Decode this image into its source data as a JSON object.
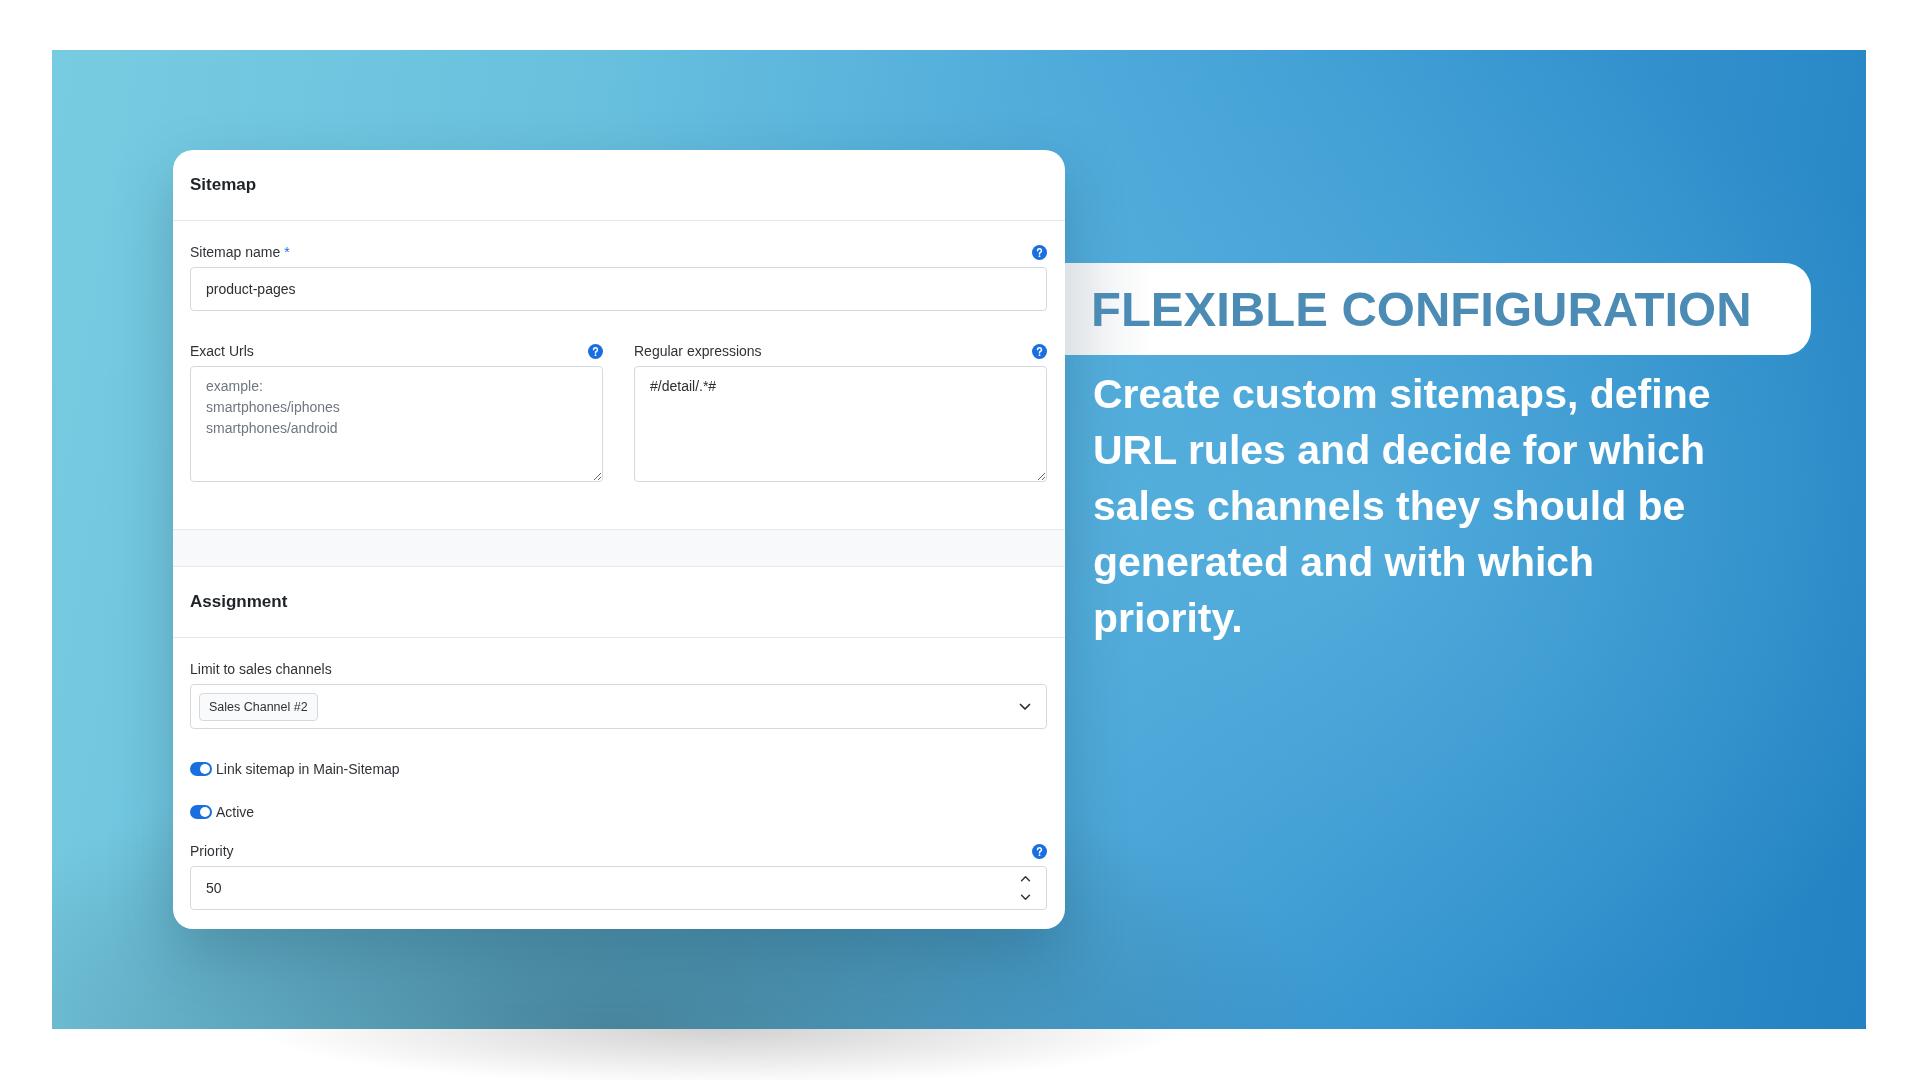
{
  "card": {
    "sections": [
      {
        "title": "Sitemap",
        "rows": [
          [
            {
              "kind": "input",
              "label": "Sitemap name",
              "required_mark": "*",
              "help": true,
              "value": "product-pages"
            }
          ],
          [
            {
              "kind": "textarea",
              "label": "Exact Urls",
              "help": true,
              "placeholder": "example:\nsmartphones/iphones\nsmartphones/android"
            },
            {
              "kind": "textarea",
              "label": "Regular expressions",
              "help": true,
              "value": "#/detail/.*#"
            }
          ]
        ]
      },
      {
        "title": "Assignment",
        "rows": [
          [
            {
              "kind": "multiselect",
              "label": "Limit to sales channels",
              "help": false,
              "tags": [
                "Sales Channel #2"
              ]
            }
          ],
          [
            {
              "kind": "switch",
              "label": "Link sitemap in Main-Sitemap",
              "help": false,
              "on": true
            }
          ],
          [
            {
              "kind": "switch",
              "label": "Active",
              "help": false,
              "on": true
            }
          ],
          [
            {
              "kind": "number",
              "label": "Priority",
              "help": true,
              "value": "50"
            }
          ]
        ]
      }
    ]
  },
  "promo": {
    "heading": "FLEXIBLE CONFIGURATION",
    "text": "Create custom sitemaps, define URL rules and decide for which sales channels they should be generated and with which priority."
  }
}
